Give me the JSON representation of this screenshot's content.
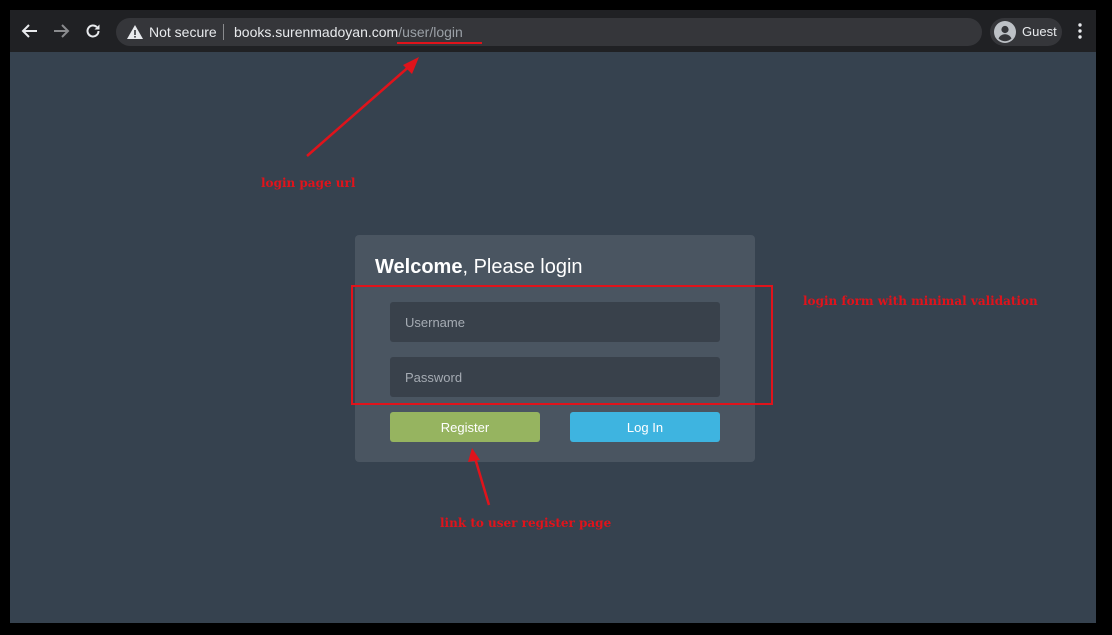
{
  "browser": {
    "security_label": "Not secure",
    "url_host": "books.surenmadoyan.com",
    "url_path": "/user/login",
    "profile_label": "Guest"
  },
  "login": {
    "title_bold": "Welcome",
    "title_rest": ", Please login",
    "username_placeholder": "Username",
    "password_placeholder": "Password",
    "register_label": "Register",
    "login_label": "Log In"
  },
  "annotations": {
    "url_note": "login page url",
    "form_note": "login form with minimal validation",
    "register_note": "link to user register page"
  },
  "colors": {
    "annotation": "#e0131b",
    "register_button": "#96b460",
    "login_button": "#3eb4e0",
    "page_background": "#36424f"
  }
}
